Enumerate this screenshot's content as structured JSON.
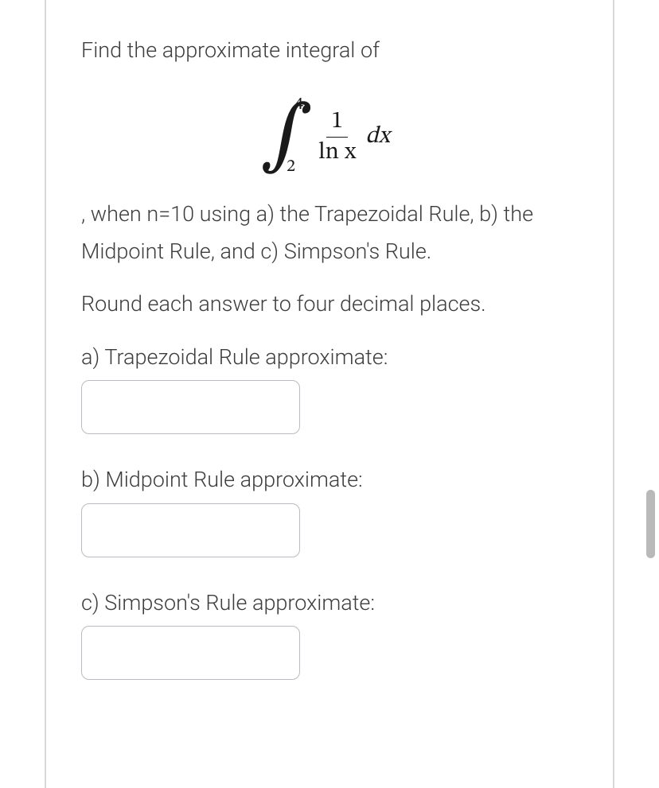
{
  "prompt": {
    "line1": "Find the approximate integral of",
    "integral": {
      "upper": "4",
      "lower": "2",
      "numerator": "1",
      "denominator": "ln x",
      "dx": "dx"
    },
    "line2": ", when n=10 using a) the Trapezoidal Rule, b) the Midpoint Rule, and c) Simpson's Rule.",
    "line3": "Round each answer to four decimal places."
  },
  "parts": {
    "a": {
      "label": "a) Trapezoidal Rule approximate:",
      "value": ""
    },
    "b": {
      "label": "b) Midpoint Rule approximate:",
      "value": ""
    },
    "c": {
      "label": "c) Simpson's Rule approximate:",
      "value": ""
    }
  }
}
